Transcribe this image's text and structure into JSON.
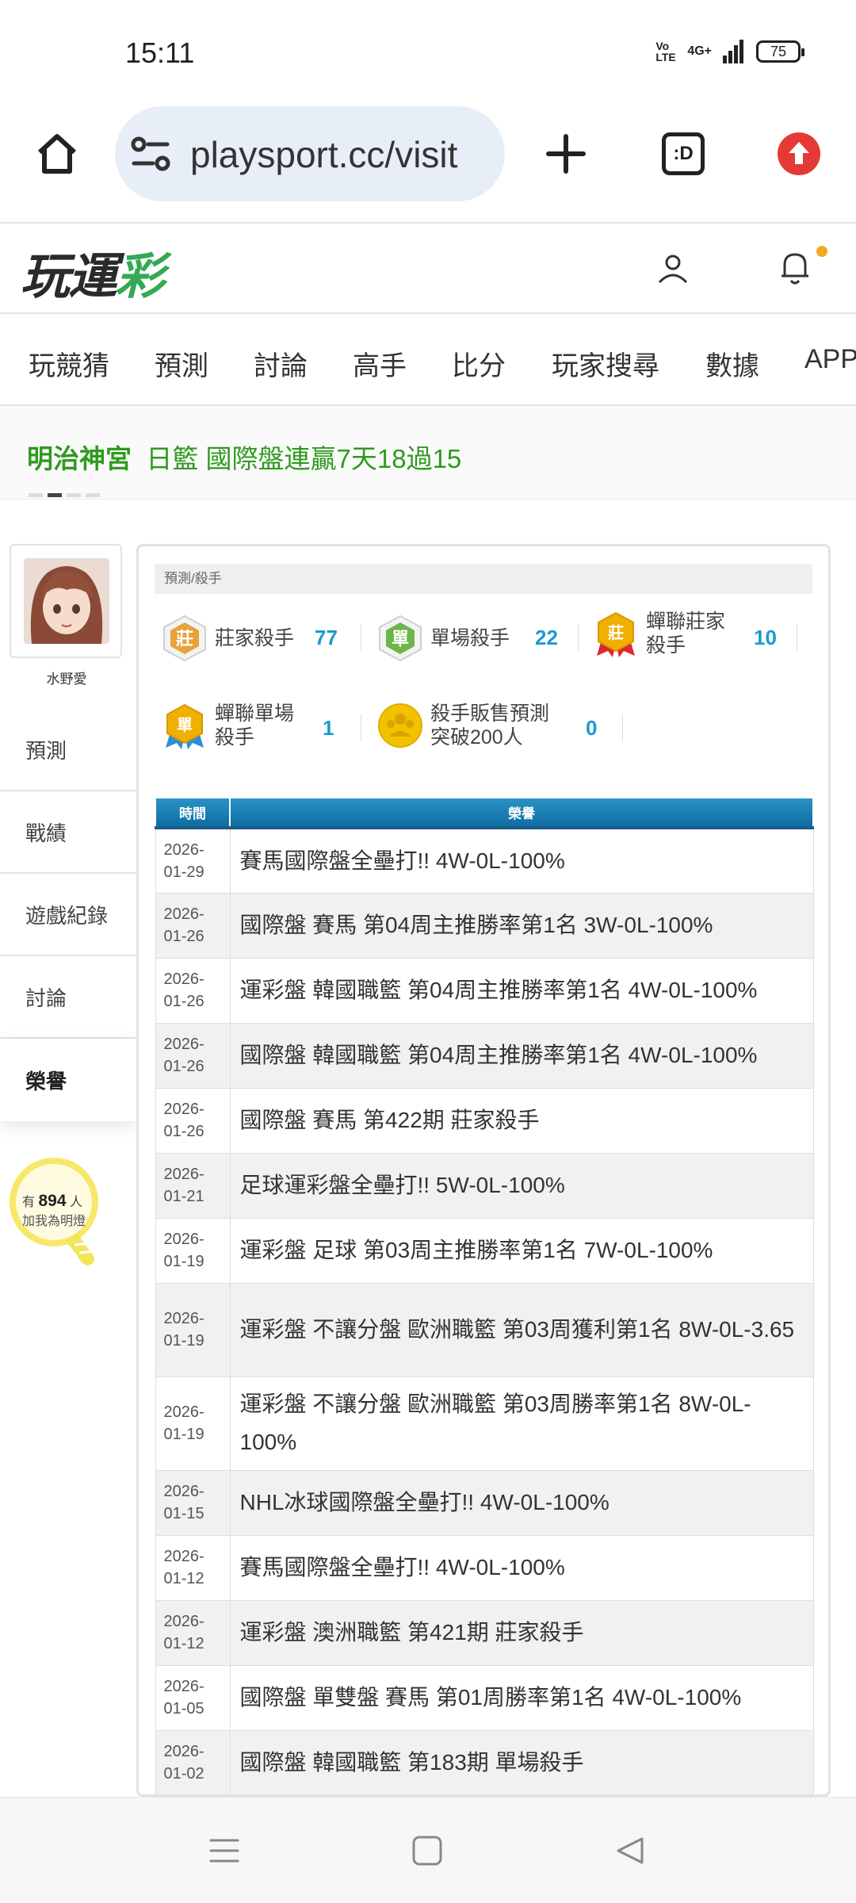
{
  "status": {
    "time": "15:11",
    "network": "4G+",
    "volte": "Vo LTE",
    "battery": "75"
  },
  "browser": {
    "url": "playsport.cc/visit",
    "tab_label": ":D"
  },
  "site": {
    "logo_a": "玩運",
    "logo_b": "彩"
  },
  "nav": [
    "玩競猜",
    "預測",
    "討論",
    "高手",
    "比分",
    "玩家搜尋",
    "數據",
    "APP"
  ],
  "ticker": {
    "team": "明治神宮",
    "text": "日籃 國際盤連贏7天18過15"
  },
  "profile": {
    "name": "水野愛"
  },
  "sidebar": [
    "預測",
    "戰績",
    "遊戲紀錄",
    "討論",
    "榮譽"
  ],
  "fans": {
    "prefix": "有",
    "count": "894",
    "suffix": "人",
    "caption": "加我為明燈"
  },
  "main": {
    "breadcrumb": "預測/殺手",
    "badges": [
      {
        "label": "莊家殺手",
        "count": "77",
        "icon": "banker-killer-badge-icon",
        "glyph": "莊",
        "color": "#e8a23a"
      },
      {
        "label": "單場殺手",
        "count": "22",
        "icon": "single-killer-badge-icon",
        "glyph": "單",
        "color": "#6fb54a"
      },
      {
        "label_line1": "蟬聯莊家",
        "label_line2": "殺手",
        "count": "10",
        "icon": "consecutive-banker-badge-icon",
        "glyph": "莊",
        "color": "#f0b000"
      },
      {
        "label_line1": "蟬聯單場",
        "label_line2": "殺手",
        "count": "1",
        "icon": "consecutive-single-badge-icon",
        "glyph": "單",
        "color": "#f0b000"
      },
      {
        "label_line1": "殺手販售預測",
        "label_line2": "突破200人",
        "count": "0",
        "icon": "sales-badge-icon",
        "glyph": "",
        "color": "#f2c200"
      }
    ],
    "table": {
      "headers": [
        "時間",
        "榮譽"
      ],
      "rows": [
        {
          "d1": "2026-",
          "d2": "01-29",
          "honor": "賽馬國際盤全壘打!! 4W-0L-100%"
        },
        {
          "d1": "2026-",
          "d2": "01-26",
          "honor": "國際盤 賽馬 第04周主推勝率第1名 3W-0L-100%"
        },
        {
          "d1": "2026-",
          "d2": "01-26",
          "honor": "運彩盤 韓國職籃 第04周主推勝率第1名 4W-0L-100%"
        },
        {
          "d1": "2026-",
          "d2": "01-26",
          "honor": "國際盤 韓國職籃 第04周主推勝率第1名 4W-0L-100%"
        },
        {
          "d1": "2026-",
          "d2": "01-26",
          "honor": "國際盤 賽馬 第422期 莊家殺手"
        },
        {
          "d1": "2026-",
          "d2": "01-21",
          "honor": "足球運彩盤全壘打!! 5W-0L-100%"
        },
        {
          "d1": "2026-",
          "d2": "01-19",
          "honor": "運彩盤 足球 第03周主推勝率第1名 7W-0L-100%"
        },
        {
          "d1": "2026-",
          "d2": "01-19",
          "honor": "運彩盤 不讓分盤 歐洲職籃 第03周獲利第1名 8W-0L-3.65"
        },
        {
          "d1": "2026-",
          "d2": "01-19",
          "honor": "運彩盤 不讓分盤 歐洲職籃 第03周勝率第1名 8W-0L-100%"
        },
        {
          "d1": "2026-",
          "d2": "01-15",
          "honor": "NHL冰球國際盤全壘打!! 4W-0L-100%"
        },
        {
          "d1": "2026-",
          "d2": "01-12",
          "honor": "賽馬國際盤全壘打!! 4W-0L-100%"
        },
        {
          "d1": "2026-",
          "d2": "01-12",
          "honor": "運彩盤 澳洲職籃 第421期 莊家殺手"
        },
        {
          "d1": "2026-",
          "d2": "01-05",
          "honor": "國際盤 單雙盤 賽馬 第01周勝率第1名 4W-0L-100%"
        },
        {
          "d1": "2026-",
          "d2": "01-02",
          "honor": "國際盤 韓國職籃 第183期 單場殺手"
        }
      ]
    }
  },
  "colors": {
    "accent_green": "#2f9a1f",
    "count_blue": "#1a9ad0",
    "header_blue": "#1b7fb5",
    "notify_dot": "#f5a623",
    "upload_red": "#e53935"
  }
}
